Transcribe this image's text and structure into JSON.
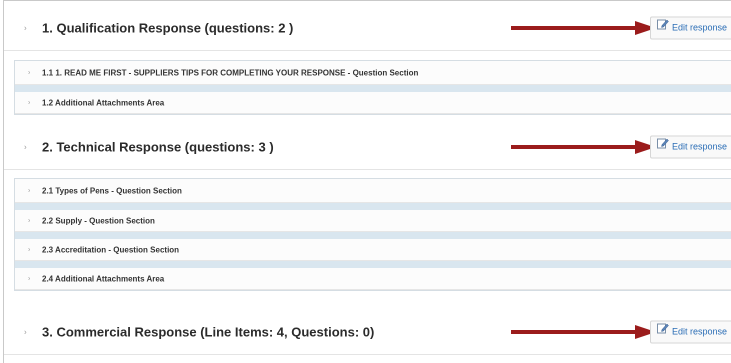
{
  "colors": {
    "arrow": "#9b1c1c",
    "link": "#2a6db5",
    "band": "#d9e6ef"
  },
  "icons": {
    "caret": "caret-right-icon",
    "edit": "edit-icon"
  },
  "sections": [
    {
      "caret": "›",
      "title": "1. Qualification Response (questions: 2 )",
      "edit_label": "Edit response",
      "items": [
        {
          "caret": "›",
          "label": "1.1  1. READ ME FIRST - SUPPLIERS TIPS FOR COMPLETING YOUR RESPONSE - Question Section"
        },
        {
          "caret": "›",
          "label": "1.2 Additional Attachments Area"
        }
      ]
    },
    {
      "caret": "›",
      "title": "2. Technical Response (questions: 3 )",
      "edit_label": "Edit response",
      "items": [
        {
          "caret": "›",
          "label": "2.1  Types of Pens - Question Section"
        },
        {
          "caret": "›",
          "label": "2.2  Supply - Question Section"
        },
        {
          "caret": "›",
          "label": "2.3  Accreditation - Question Section"
        },
        {
          "caret": "›",
          "label": "2.4 Additional Attachments Area"
        }
      ]
    },
    {
      "caret": "›",
      "title": "3. Commercial Response (Line Items: 4, Questions: 0)",
      "edit_label": "Edit response",
      "items": []
    }
  ]
}
